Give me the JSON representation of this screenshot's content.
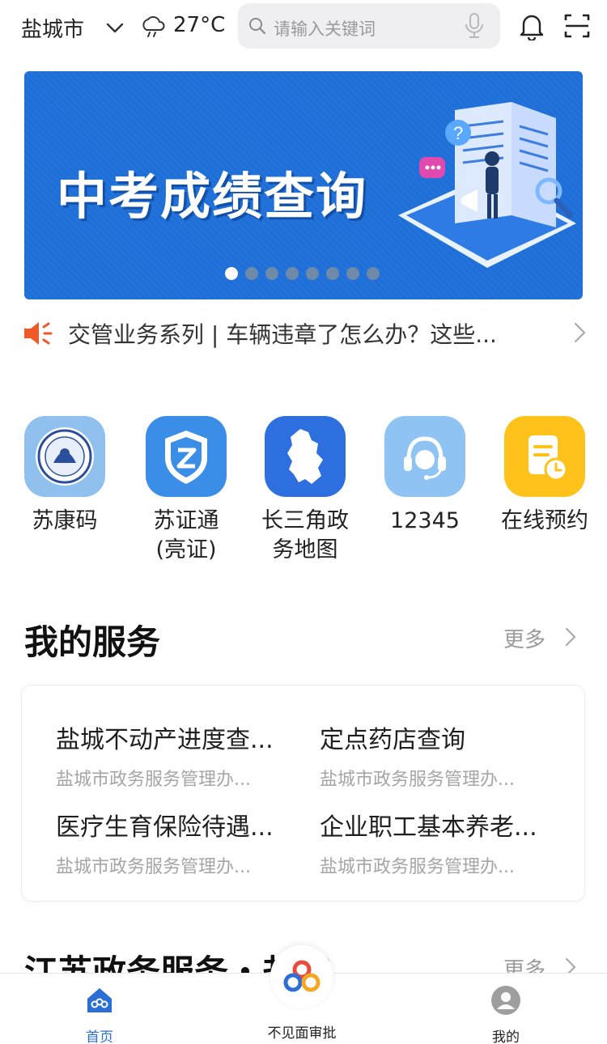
{
  "header": {
    "city": "盐城市",
    "temperature": "27°C",
    "search_placeholder": "请输入关键词"
  },
  "banner": {
    "title": "中考成绩查询",
    "slide_count": 8,
    "active_slide": 1
  },
  "notice": {
    "text": "交管业务系列 | 车辆违章了怎么办？这些..."
  },
  "quick_apps": [
    {
      "label_line1": "苏康码",
      "label_line2": ""
    },
    {
      "label_line1": "苏证通",
      "label_line2": "(亮证)"
    },
    {
      "label_line1": "长三角政",
      "label_line2": "务地图"
    },
    {
      "label_line1": "12345",
      "label_line2": ""
    },
    {
      "label_line1": "在线预约",
      "label_line2": ""
    }
  ],
  "my_services": {
    "title": "我的服务",
    "more": "更多",
    "items": [
      {
        "title": "盐城不动产进度查...",
        "subtitle": "盐城市政务服务管理办..."
      },
      {
        "title": "定点药店查询",
        "subtitle": "盐城市政务服务管理办..."
      },
      {
        "title": "医疗生育保险待遇...",
        "subtitle": "盐城市政务服务管理办..."
      },
      {
        "title": "企业职工基本养老...",
        "subtitle": "盐城市政务服务管理办..."
      }
    ]
  },
  "section2": {
    "title": "江苏政务服务・盐城",
    "more": "更多"
  },
  "bottom_nav": {
    "home": "首页",
    "center": "不见面审批",
    "mine": "我的"
  },
  "colors": {
    "accent": "#2b6fd6",
    "banner_bg": "#1f6fd8",
    "notice_icon": "#f05a28",
    "app_yellow": "#ffc21a",
    "app_blue": "#3a8ee8"
  }
}
